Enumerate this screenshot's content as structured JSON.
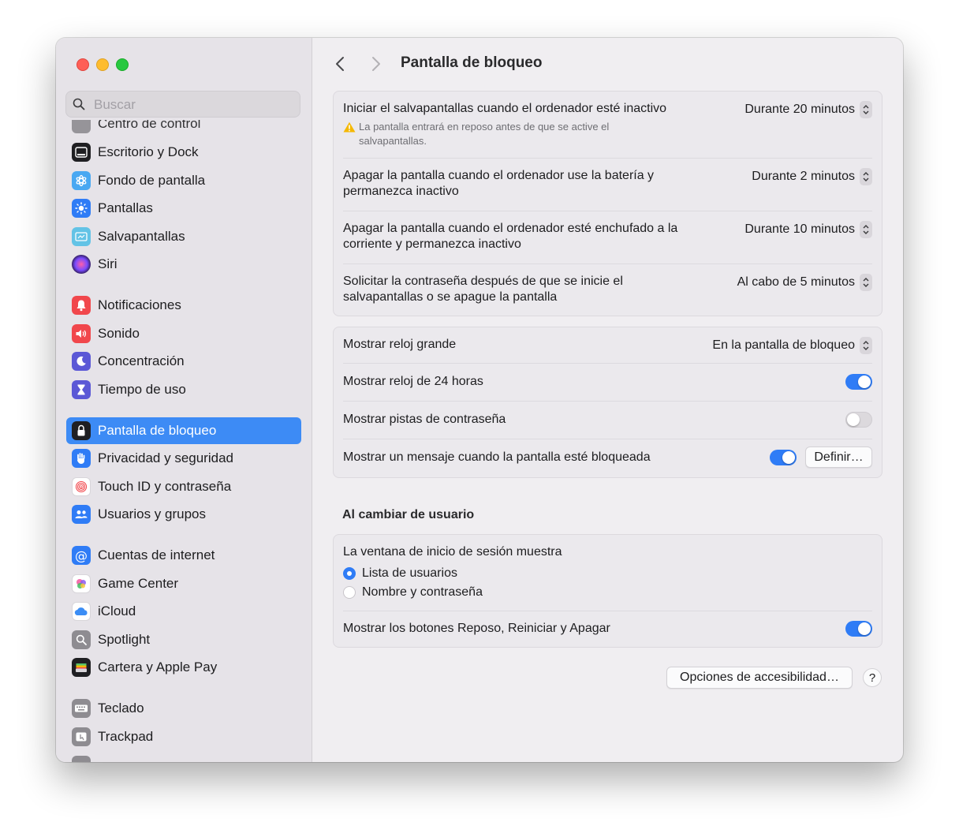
{
  "window": {
    "title": "Pantalla de bloqueo"
  },
  "search": {
    "placeholder": "Buscar",
    "value": ""
  },
  "sidebar": {
    "partial_top_label": "Centro de control",
    "items": [
      {
        "label": "Escritorio y Dock",
        "icon": "dock-icon",
        "color": "#1f1f22"
      },
      {
        "label": "Fondo de pantalla",
        "icon": "wallpaper-icon",
        "color": "#49a8f2"
      },
      {
        "label": "Pantallas",
        "icon": "brightness-icon",
        "color": "#2f7cf6"
      },
      {
        "label": "Salvapantallas",
        "icon": "screensaver-icon",
        "color": "#63c3e6"
      },
      {
        "label": "Siri",
        "icon": "siri-icon",
        "color": "#3a1f5c"
      },
      {
        "label": "Notificaciones",
        "icon": "bell-icon",
        "color": "#f1474c"
      },
      {
        "label": "Sonido",
        "icon": "speaker-icon",
        "color": "#f1474c"
      },
      {
        "label": "Concentración",
        "icon": "moon-icon",
        "color": "#5b58d6"
      },
      {
        "label": "Tiempo de uso",
        "icon": "hourglass-icon",
        "color": "#5b58d6"
      },
      {
        "label": "Pantalla de bloqueo",
        "icon": "lock-icon",
        "color": "#1f1f22",
        "selected": true
      },
      {
        "label": "Privacidad y seguridad",
        "icon": "hand-icon",
        "color": "#2f7cf6"
      },
      {
        "label": "Touch ID y contraseña",
        "icon": "fingerprint-icon",
        "color": "#ffffff"
      },
      {
        "label": "Usuarios y grupos",
        "icon": "users-icon",
        "color": "#2f7cf6"
      },
      {
        "label": "Cuentas de internet",
        "icon": "at-icon",
        "color": "#2f7cf6"
      },
      {
        "label": "Game Center",
        "icon": "game-center-icon",
        "color": "#ffffff"
      },
      {
        "label": "iCloud",
        "icon": "cloud-icon",
        "color": "#ffffff"
      },
      {
        "label": "Spotlight",
        "icon": "magnifier-icon",
        "color": "#8e8c91"
      },
      {
        "label": "Cartera y Apple Pay",
        "icon": "wallet-icon",
        "color": "#1f1f22"
      },
      {
        "label": "Teclado",
        "icon": "keyboard-icon",
        "color": "#8e8c91"
      },
      {
        "label": "Trackpad",
        "icon": "trackpad-icon",
        "color": "#8e8c91"
      }
    ]
  },
  "settings": {
    "screensaver_row": {
      "label": "Iniciar el salvapantallas cuando el ordenador esté inactivo",
      "value": "Durante 20 minutos",
      "warning": "La pantalla entrará en reposo antes de que se active el salvapantallas."
    },
    "battery_row": {
      "label": "Apagar la pantalla cuando el ordenador use la batería y permanezca inactivo",
      "value": "Durante 2 minutos"
    },
    "power_row": {
      "label": "Apagar la pantalla cuando el ordenador esté enchufado a la corriente y permanezca inactivo",
      "value": "Durante 10 minutos"
    },
    "password_row": {
      "label": "Solicitar la contraseña después de que se inicie el salvapantallas o se apague la pantalla",
      "value": "Al cabo de 5 minutos"
    },
    "clock_big_row": {
      "label": "Mostrar reloj grande",
      "value": "En la pantalla de bloqueo"
    },
    "clock24_row": {
      "label": "Mostrar reloj de 24 horas",
      "enabled": true
    },
    "hints_row": {
      "label": "Mostrar pistas de contraseña",
      "enabled": false
    },
    "message_row": {
      "label": "Mostrar un mensaje cuando la pantalla esté bloqueada",
      "enabled": true,
      "button": "Definir…"
    }
  },
  "user_switch": {
    "title": "Al cambiar de usuario",
    "login_label": "La ventana de inicio de sesión muestra",
    "options": [
      {
        "label": "Lista de usuarios",
        "selected": true
      },
      {
        "label": "Nombre y contraseña",
        "selected": false
      }
    ],
    "power_buttons": {
      "label": "Mostrar los botones Reposo, Reiniciar y Apagar",
      "enabled": true
    }
  },
  "footer": {
    "accessibility_button": "Opciones de accesibilidad…",
    "help": "?"
  },
  "colors": {
    "accent": "#2f7cf6",
    "selection": "#3d8bf5",
    "warning": "#f5b800"
  }
}
